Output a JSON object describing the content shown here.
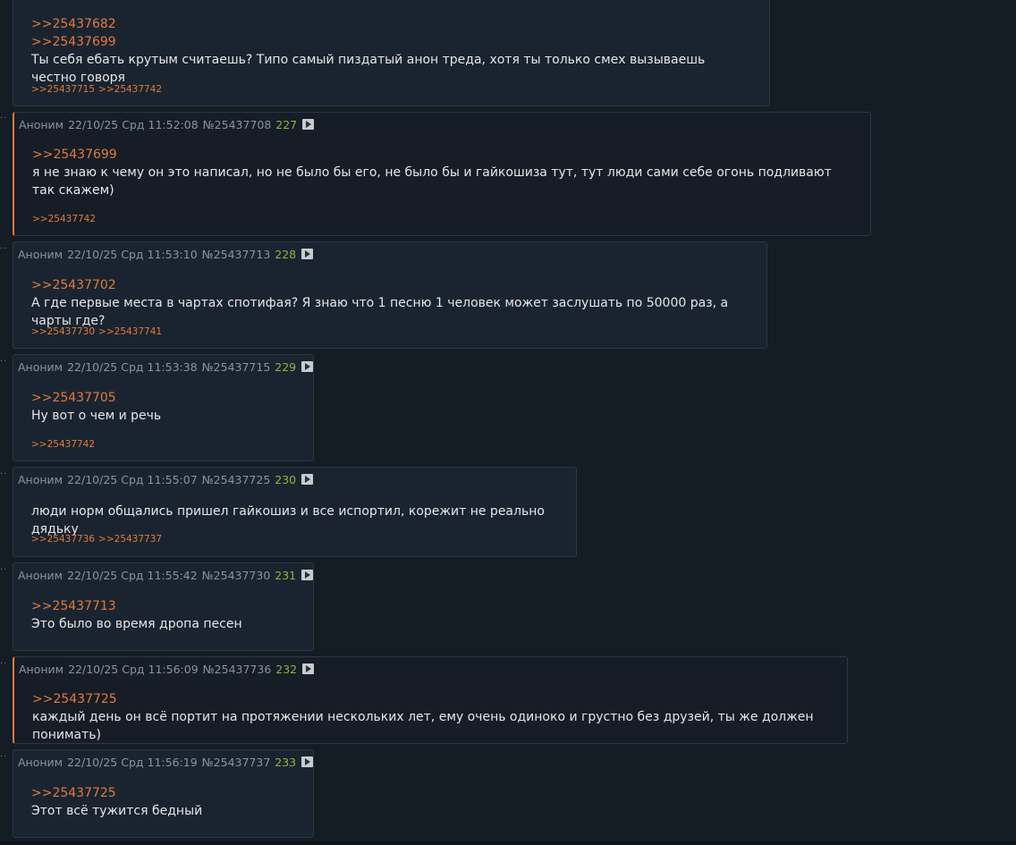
{
  "posts": [
    {
      "refs": [
        ">>25437682",
        ">>25437699"
      ],
      "text": "Ты себя ебать крутым считаешь? Типо самый пиздатый анон треда, хотя ты только смех вызываешь честно говоря",
      "replies": [
        ">>25437715",
        ">>25437742"
      ]
    },
    {
      "author": "Аноним",
      "date": "22/10/25 Срд 11:52:08",
      "id": "№25437708",
      "num": "227",
      "refs": [
        ">>25437699"
      ],
      "text": "я не знаю к чему он это написал, но не было бы его, не было бы и гайкошиза тут, тут люди сами себе огонь подливают так скажем)",
      "replies": [
        ">>25437742"
      ]
    },
    {
      "author": "Аноним",
      "date": "22/10/25 Срд 11:53:10",
      "id": "№25437713",
      "num": "228",
      "refs": [
        ">>25437702"
      ],
      "text": "А где первые места в чартах спотифая? Я знаю что 1 песню 1 человек может заслушать по 50000 раз, а чарты где?",
      "replies": [
        ">>25437730",
        ">>25437741"
      ]
    },
    {
      "author": "Аноним",
      "date": "22/10/25 Срд 11:53:38",
      "id": "№25437715",
      "num": "229",
      "refs": [
        ">>25437705"
      ],
      "text": "Ну вот о чем и речь",
      "replies": [
        ">>25437742"
      ]
    },
    {
      "author": "Аноним",
      "date": "22/10/25 Срд 11:55:07",
      "id": "№25437725",
      "num": "230",
      "refs": [],
      "text": "люди норм общались пришел гайкошиз и все испортил, корежит не реально дядьку",
      "replies": [
        ">>25437736",
        ">>25437737"
      ]
    },
    {
      "author": "Аноним",
      "date": "22/10/25 Срд 11:55:42",
      "id": "№25437730",
      "num": "231",
      "refs": [
        ">>25437713"
      ],
      "text": "Это было во время дропа песен",
      "replies": []
    },
    {
      "author": "Аноним",
      "date": "22/10/25 Срд 11:56:09",
      "id": "№25437736",
      "num": "232",
      "refs": [
        ">>25437725"
      ],
      "text": "каждый день он всё портит на протяжении нескольких лет, ему очень одиноко и грустно без друзей, ты же должен понимать)",
      "replies": []
    },
    {
      "author": "Аноним",
      "date": "22/10/25 Срд 11:56:19",
      "id": "№25437737",
      "num": "233",
      "refs": [
        ">>25437725"
      ],
      "text": "Этот всё тужится бедный",
      "replies": []
    }
  ],
  "icons": {
    "post_dots": "drag-dots-icon",
    "play": "play-icon"
  },
  "colors": {
    "link": "#e07a3c",
    "post_number": "#8fb33a",
    "background": "#141c24",
    "post_bg": "#1a2430"
  }
}
